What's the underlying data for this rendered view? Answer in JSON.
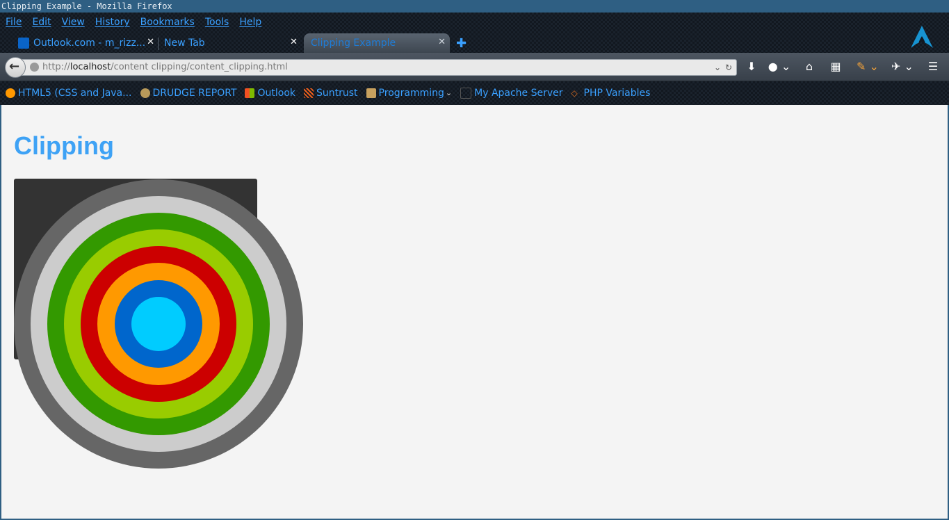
{
  "window": {
    "title": "Clipping Example - Mozilla Firefox"
  },
  "menu": [
    "File",
    "Edit",
    "View",
    "History",
    "Bookmarks",
    "Tools",
    "Help"
  ],
  "tabs": [
    {
      "label": "Outlook.com - m_rizz...",
      "icon": "outlook-icon",
      "active": false
    },
    {
      "label": "New Tab",
      "icon": "none",
      "active": false
    },
    {
      "label": "Clipping Example",
      "icon": "none",
      "active": true
    }
  ],
  "urlbar": {
    "scheme": "http://",
    "host": "localhost",
    "path": "/content clipping/content_clipping.html"
  },
  "bookmarks": [
    {
      "label": "HTML5 (CSS and Java...",
      "icon": "html5-icon",
      "color": "#ff9800"
    },
    {
      "label": "DRUDGE REPORT",
      "icon": "drudge-icon",
      "color": "#b89a5a"
    },
    {
      "label": "Outlook",
      "icon": "windows-icon",
      "color": "#f25022"
    },
    {
      "label": "Suntrust",
      "icon": "suntrust-icon",
      "color": "#e85d1c"
    },
    {
      "label": "Programming",
      "icon": "folder-icon",
      "color": "#c8a15e"
    },
    {
      "label": "My Apache Server",
      "icon": "apache-icon",
      "color": "#555555"
    },
    {
      "label": "PHP Variables",
      "icon": "php-icon",
      "color": "#e07020"
    }
  ],
  "page": {
    "heading": "Clipping",
    "heading_color": "#3ea2f5",
    "box_color": "#333333",
    "rings": [
      "#666666",
      "#cccccc",
      "#339900",
      "#99cc00",
      "#cc0000",
      "#ff9900",
      "#0066cc",
      "#00ccff"
    ]
  }
}
